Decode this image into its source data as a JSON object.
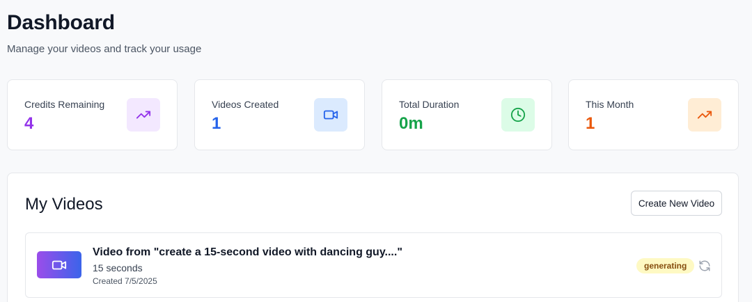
{
  "header": {
    "title": "Dashboard",
    "subtitle": "Manage your videos and track your usage"
  },
  "stats": [
    {
      "label": "Credits Remaining",
      "value": "4",
      "icon": "trending-up-icon",
      "value_color": "#9333ea",
      "icon_color": "#9333ea",
      "icon_bg": "#f3e8ff"
    },
    {
      "label": "Videos Created",
      "value": "1",
      "icon": "video-icon",
      "value_color": "#2563eb",
      "icon_color": "#2563eb",
      "icon_bg": "#dbeafe"
    },
    {
      "label": "Total Duration",
      "value": "0m",
      "icon": "clock-icon",
      "value_color": "#16a34a",
      "icon_color": "#16a34a",
      "icon_bg": "#dcfce7"
    },
    {
      "label": "This Month",
      "value": "1",
      "icon": "trending-up-icon",
      "value_color": "#ea580c",
      "icon_color": "#ea580c",
      "icon_bg": "#ffedd5"
    }
  ],
  "videos_section": {
    "title": "My Videos",
    "create_button_label": "Create New Video",
    "items": [
      {
        "title": "Video from \"create a 15-second video with dancing guy....\"",
        "duration": "15 seconds",
        "created": "Created 7/5/2025",
        "status": "generating",
        "thumbnail_icon": "video-icon",
        "action_icon": "refresh-icon"
      }
    ]
  }
}
